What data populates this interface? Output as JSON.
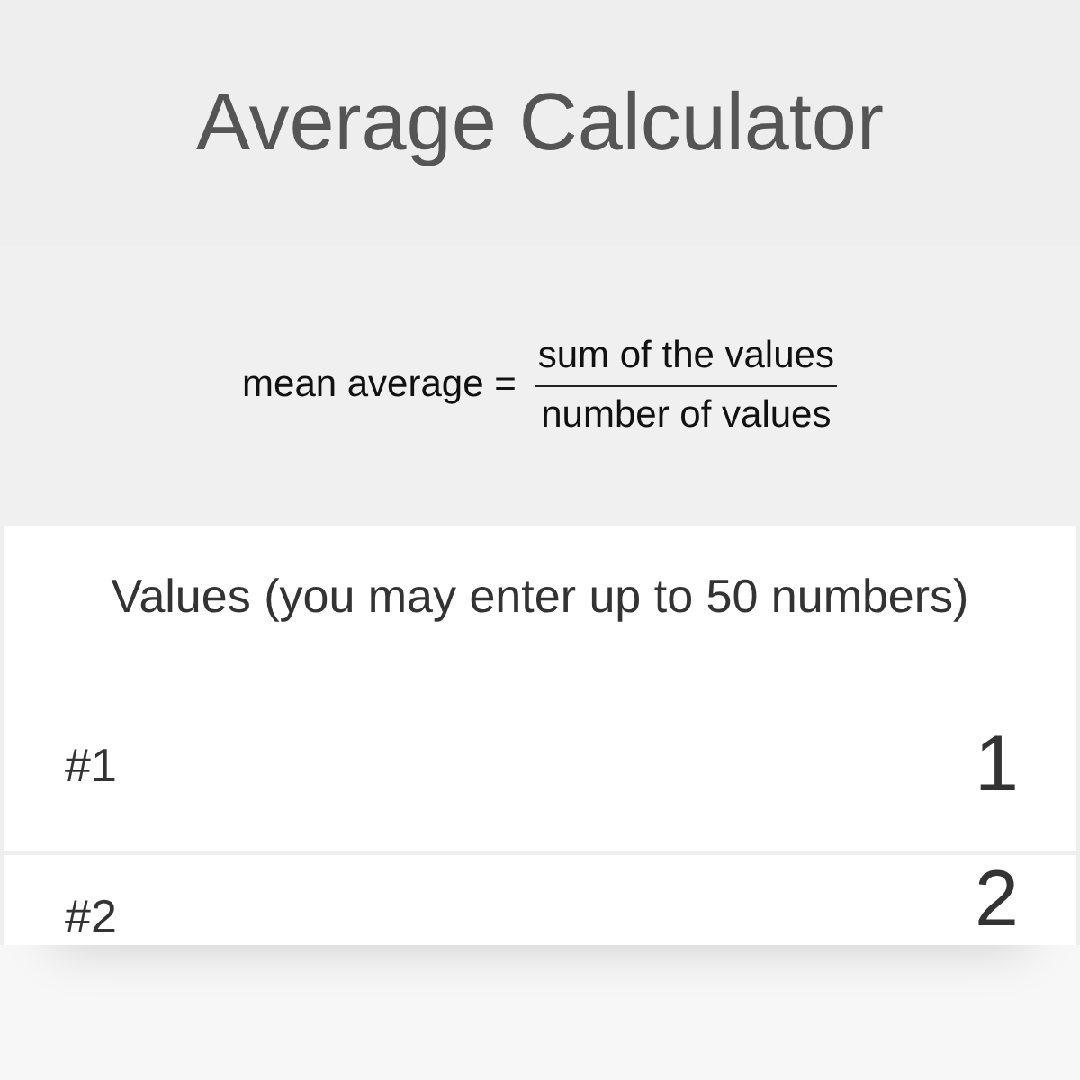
{
  "title": "Average Calculator",
  "formula": {
    "lhs": "mean average =",
    "numerator": "sum of the values",
    "denominator": "number of values"
  },
  "values_label": "Values (you may enter up to 50 numbers)",
  "rows": [
    {
      "label": "#1",
      "value": "1"
    },
    {
      "label": "#2",
      "value": "2"
    }
  ]
}
